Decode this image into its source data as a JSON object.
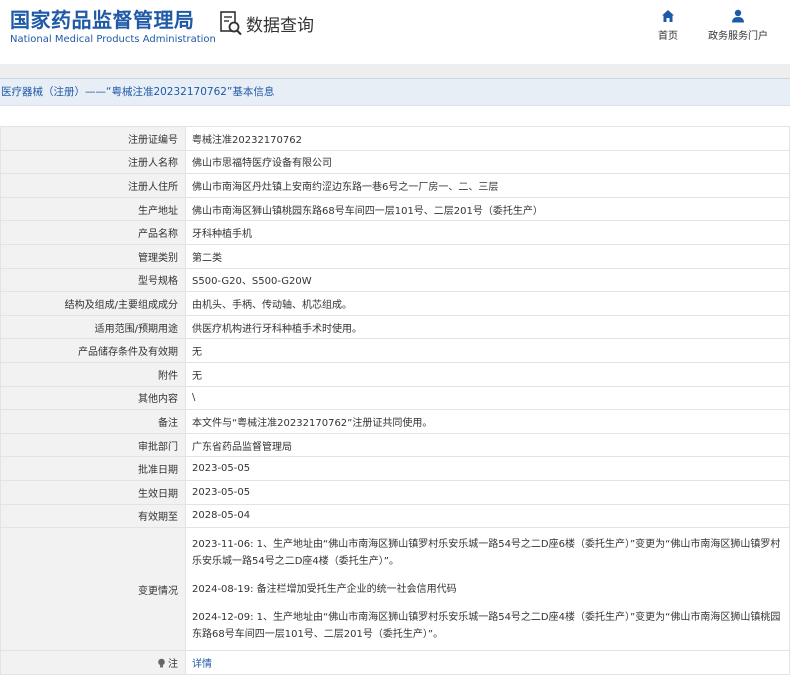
{
  "header": {
    "brand_cn": "国家药品监督管理局",
    "brand_en": "National Medical Products Administration",
    "query_label": "数据查询",
    "nav_home": "首页",
    "nav_service": "政务服务门户"
  },
  "breadcrumb": "医疗器械（注册）——“粤械注准20232170762”基本信息",
  "rows": [
    {
      "label": "注册证编号",
      "value": "粤械注准20232170762"
    },
    {
      "label": "注册人名称",
      "value": "佛山市思福特医疗设备有限公司"
    },
    {
      "label": "注册人住所",
      "value": "佛山市南海区丹灶镇上安南约涩边东路一巷6号之一厂房一、二、三层"
    },
    {
      "label": "生产地址",
      "value": "佛山市南海区狮山镇桃园东路68号车间四一层101号、二层201号（委托生产）"
    },
    {
      "label": "产品名称",
      "value": "牙科种植手机"
    },
    {
      "label": "管理类别",
      "value": "第二类"
    },
    {
      "label": "型号规格",
      "value": "S500-G20、S500-G20W"
    },
    {
      "label": "结构及组成/主要组成成分",
      "value": "由机头、手柄、传动轴、机芯组成。"
    },
    {
      "label": "适用范围/预期用途",
      "value": "供医疗机构进行牙科种植手术时使用。"
    },
    {
      "label": "产品储存条件及有效期",
      "value": "无"
    },
    {
      "label": "附件",
      "value": "无"
    },
    {
      "label": "其他内容",
      "value": "\\"
    },
    {
      "label": "备注",
      "value": "本文件与“粤械注准20232170762”注册证共同使用。"
    },
    {
      "label": "审批部门",
      "value": "广东省药品监督管理局"
    },
    {
      "label": "批准日期",
      "value": "2023-05-05"
    },
    {
      "label": "生效日期",
      "value": "2023-05-05"
    },
    {
      "label": "有效期至",
      "value": "2028-05-04"
    }
  ],
  "changes": {
    "label": "变更情况",
    "entries": [
      "2023-11-06: 1、生产地址由“佛山市南海区狮山镇罗村乐安乐城一路54号之二D座6楼（委托生产）”变更为“佛山市南海区狮山镇罗村乐安乐城一路54号之二D座4楼（委托生产）”。",
      "2024-08-19: 备注栏增加受托生产企业的统一社会信用代码",
      "2024-12-09: 1、生产地址由“佛山市南海区狮山镇罗村乐安乐城一路54号之二D座4楼（委托生产）”变更为“佛山市南海区狮山镇桃园东路68号车间四一层101号、二层201号（委托生产）”。"
    ]
  },
  "note": {
    "label": "注",
    "link": "详情"
  },
  "colors": {
    "brand_blue": "#1f5aa6",
    "label_bg": "#f2f2f2",
    "breadcrumb_bg": "#e8eef6"
  },
  "icons": [
    "search-document-icon",
    "home-icon",
    "user-icon",
    "bulb-icon"
  ]
}
